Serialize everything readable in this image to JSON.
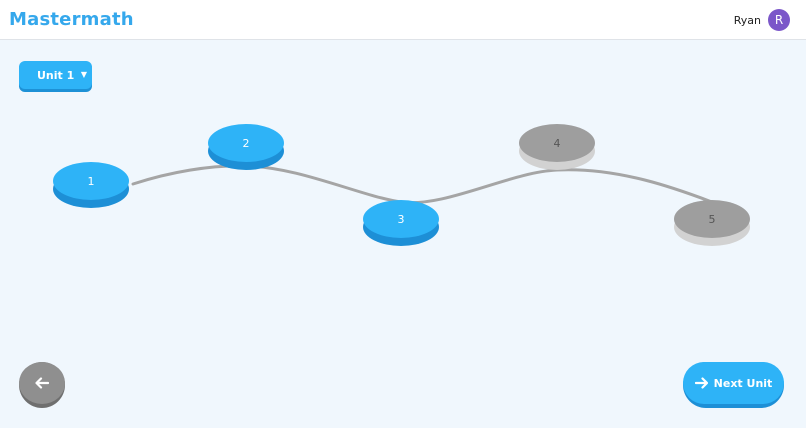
{
  "header": {
    "brand": "Mastermath",
    "user_name": "Ryan",
    "avatar_initial": "R"
  },
  "unit_selector": {
    "selected": "Unit 1",
    "icon": "chevron-down-icon"
  },
  "lesson_nodes": [
    {
      "label": "1",
      "state": "completed"
    },
    {
      "label": "2",
      "state": "completed"
    },
    {
      "label": "3",
      "state": "completed"
    },
    {
      "label": "4",
      "state": "locked"
    },
    {
      "label": "5",
      "state": "locked"
    }
  ],
  "footer": {
    "back_icon": "arrow-left-icon",
    "next_label": "Next Unit",
    "next_icon": "arrow-right-icon"
  },
  "colors": {
    "brand": "#35a8ec",
    "node_active": "#2eb3f7",
    "node_locked": "#9e9e9e",
    "path": "#a5a5a5",
    "avatar": "#7b57c9"
  }
}
